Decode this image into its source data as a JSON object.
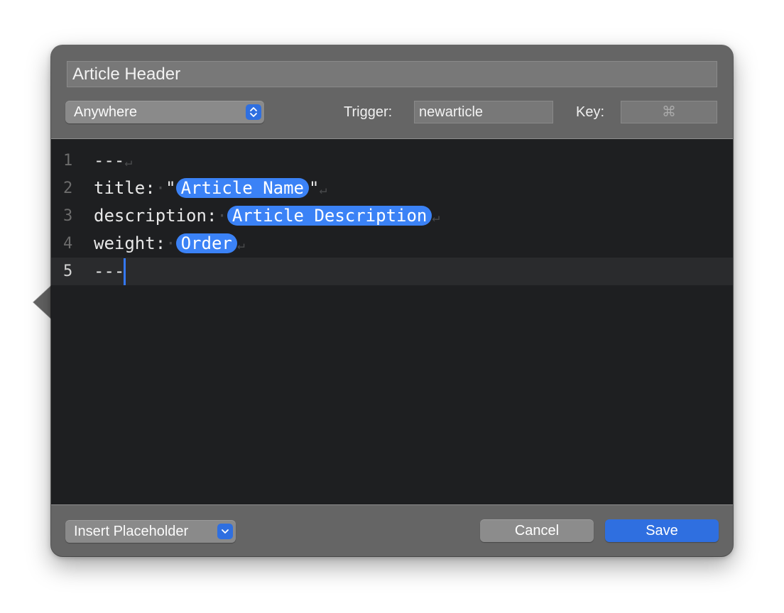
{
  "snippet": {
    "title": "Article Header"
  },
  "scope": {
    "selected": "Anywhere",
    "icon": "up-down-chevron-icon"
  },
  "trigger": {
    "label": "Trigger:",
    "value": "newarticle"
  },
  "key": {
    "label": "Key:",
    "value": "⌘"
  },
  "editor": {
    "current_line": 5,
    "lines": [
      {
        "number": "1",
        "text": "---"
      },
      {
        "number": "2",
        "prefix": "title:",
        "open_quote": "\"",
        "placeholder": "Article Name",
        "close_quote": "\""
      },
      {
        "number": "3",
        "prefix": "description:",
        "placeholder": "Article Description"
      },
      {
        "number": "4",
        "prefix": "weight:",
        "placeholder": "Order"
      },
      {
        "number": "5",
        "text": "---"
      }
    ],
    "whitespace_glyph": "·",
    "return_glyph": "↵"
  },
  "footer": {
    "insert_placeholder_label": "Insert Placeholder",
    "cancel_label": "Cancel",
    "save_label": "Save"
  },
  "colors": {
    "accent": "#2f6fe0",
    "placeholder_token": "#3b82f6",
    "editor_bg": "#1e1f21",
    "panel_bg": "#656565"
  }
}
